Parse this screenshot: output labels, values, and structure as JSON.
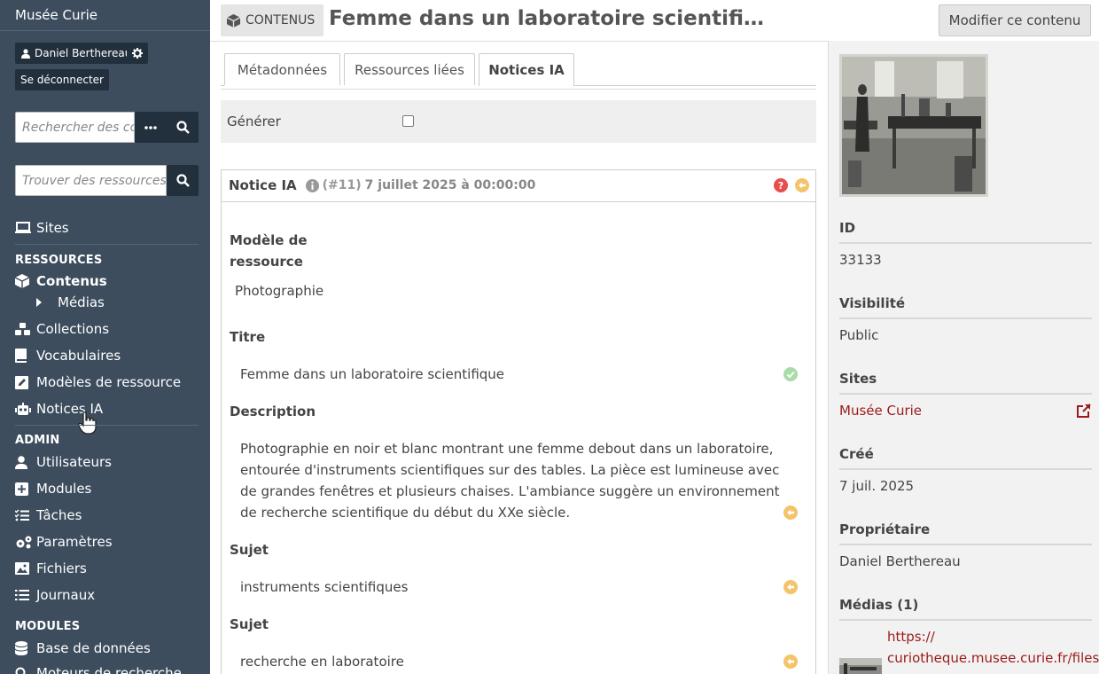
{
  "sidebar": {
    "site_title": "Musée Curie",
    "user_name": "Daniel Berthereau",
    "logout_label": "Se déconnecter",
    "search_placeholder": "Rechercher des contenus",
    "find_placeholder": "Trouver des ressources…",
    "nav": {
      "sites": "Sites",
      "section_resources": "RESSOURCES",
      "contenus": "Contenus",
      "medias": "Médias",
      "collections": "Collections",
      "vocabulaires": "Vocabulaires",
      "modeles": "Modèles de ressource",
      "notices_ia": "Notices IA",
      "section_admin": "ADMIN",
      "utilisateurs": "Utilisateurs",
      "modules": "Modules",
      "taches": "Tâches",
      "parametres": "Paramètres",
      "fichiers": "Fichiers",
      "journaux": "Journaux",
      "section_modules": "MODULES",
      "base_donnees": "Base de données",
      "moteurs": "Moteurs de recherche"
    }
  },
  "header": {
    "badge": "CONTENUS",
    "title": "Femme dans un laboratoire scientifi…",
    "edit_button": "Modifier ce contenu"
  },
  "tabs": [
    "Métadonnées",
    "Ressources liées",
    "Notices IA"
  ],
  "generate_label": "Générer",
  "notice": {
    "title": "Notice IA",
    "id": "(#11)",
    "date": "7 juillet 2025 à 00:00:00",
    "template_label": "Modèle de ressource",
    "template_value": "Photographie",
    "titre_label": "Titre",
    "titre_value": "Femme dans un laboratoire scientifique",
    "description_label": "Description",
    "description_value": "Photographie en noir et blanc montrant une femme debout dans un laboratoire, entourée d'instruments scientifiques sur des tables. La pièce est lumineuse avec de grandes fenêtres et plusieurs chaises. L'ambiance suggère un environnement de recherche scientifique du début du XXe siècle.",
    "sujet_label": "Sujet",
    "sujet1_value": "instruments scientifiques",
    "sujet2_value": "recherche en laboratoire"
  },
  "right": {
    "id_label": "ID",
    "id_value": "33133",
    "visibility_label": "Visibilité",
    "visibility_value": "Public",
    "sites_label": "Sites",
    "sites_value": "Musée Curie",
    "created_label": "Créé",
    "created_value": "7 juil. 2025",
    "owner_label": "Propriétaire",
    "owner_value": "Daniel Berthereau",
    "media_label": "Médias (1)",
    "media_link_1": "https://",
    "media_link_2": "curiotheque.musee.curie.fr/files/"
  },
  "colors": {
    "sidebar_bg": "#3d4d5e",
    "link": "#9b1b1b",
    "accept": "#a8dca8",
    "restore": "#f5c36a",
    "help": "#e84c4c"
  }
}
